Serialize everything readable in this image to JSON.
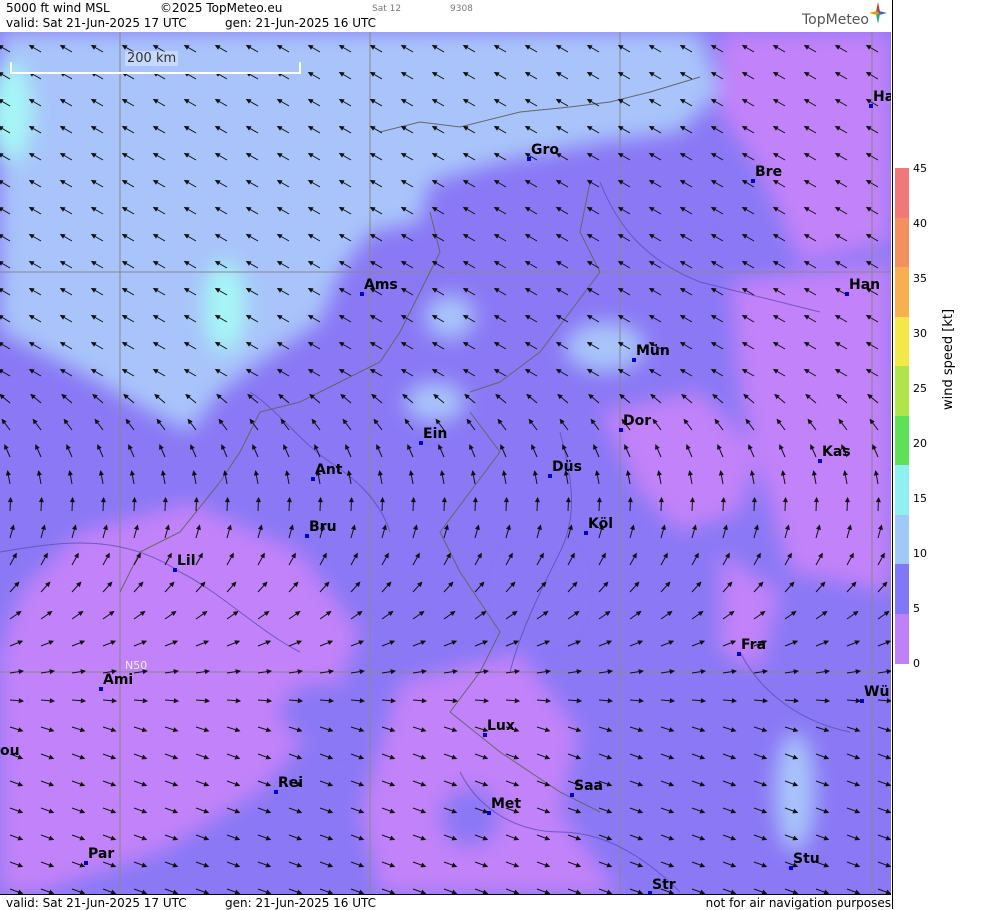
{
  "header": {
    "product": "5000 ft wind MSL",
    "copyright": "©2025 TopMeteo.eu",
    "valid": "valid:  Sat  21-Jun-2025  17 UTC",
    "gen": "gen:  21-Jun-2025 16 UTC",
    "sat": "Sat 12",
    "code": "9308",
    "logo": "TopMeteo"
  },
  "footer": {
    "valid": "valid:  Sat  21-Jun-2025  17 UTC",
    "gen": "gen:  21-Jun-2025 16 UTC",
    "disclaimer": "not for air navigation purposes"
  },
  "scale_label": "200 km",
  "latitude_label": "N50",
  "colorbar": {
    "title": "wind  speed  [kt]",
    "ticks": [
      "45",
      "40",
      "35",
      "30",
      "25",
      "20",
      "15",
      "10",
      "5",
      "0"
    ],
    "colors": [
      "#f07878",
      "#f39060",
      "#f6b050",
      "#f3e84a",
      "#b0e44a",
      "#5ee05a",
      "#90f0f0",
      "#a0c8f8",
      "#8078f8",
      "#c080f8"
    ]
  },
  "cities": [
    "Ha",
    "Gro",
    "Bre",
    "Ams",
    "Han",
    "Mün",
    "Ein",
    "Dor",
    "Ant",
    "Düs",
    "Kas",
    "Bru",
    "Köl",
    "Lil",
    "Fra",
    "Ami",
    "Wü",
    "Lux",
    "ou",
    "Rei",
    "Saa",
    "Met",
    "Par",
    "Stu",
    "Str"
  ]
}
